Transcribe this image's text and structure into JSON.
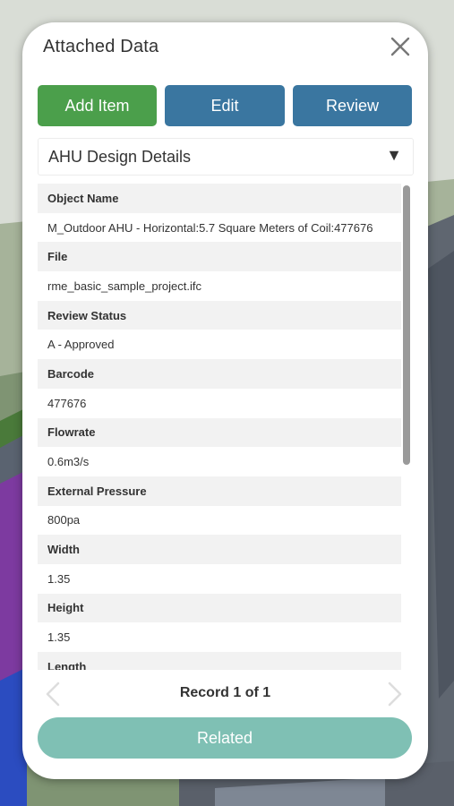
{
  "panel": {
    "title": "Attached Data",
    "close_icon": "close-icon"
  },
  "toolbar": {
    "add_label": "Add Item",
    "edit_label": "Edit",
    "review_label": "Review"
  },
  "dropdown": {
    "selected": "AHU Design Details",
    "arrow": "▼"
  },
  "fields": [
    {
      "label": "Object Name",
      "value": "M_Outdoor AHU - Horizontal:5.7 Square Meters of Coil:477676"
    },
    {
      "label": "File",
      "value": "rme_basic_sample_project.ifc"
    },
    {
      "label": "Review Status",
      "value": "A - Approved"
    },
    {
      "label": "Barcode",
      "value": "477676"
    },
    {
      "label": "Flowrate",
      "value": "0.6m3/s"
    },
    {
      "label": "External Pressure",
      "value": "800pa"
    },
    {
      "label": "Width",
      "value": "1.35"
    },
    {
      "label": "Height",
      "value": "1.35"
    },
    {
      "label": "Length",
      "value": ""
    }
  ],
  "pager": {
    "record_text": "Record 1 of 1"
  },
  "related_label": "Related",
  "colors": {
    "add": "#4b9f4b",
    "edit_review": "#3a76a0",
    "related": "#7fc0b4"
  }
}
